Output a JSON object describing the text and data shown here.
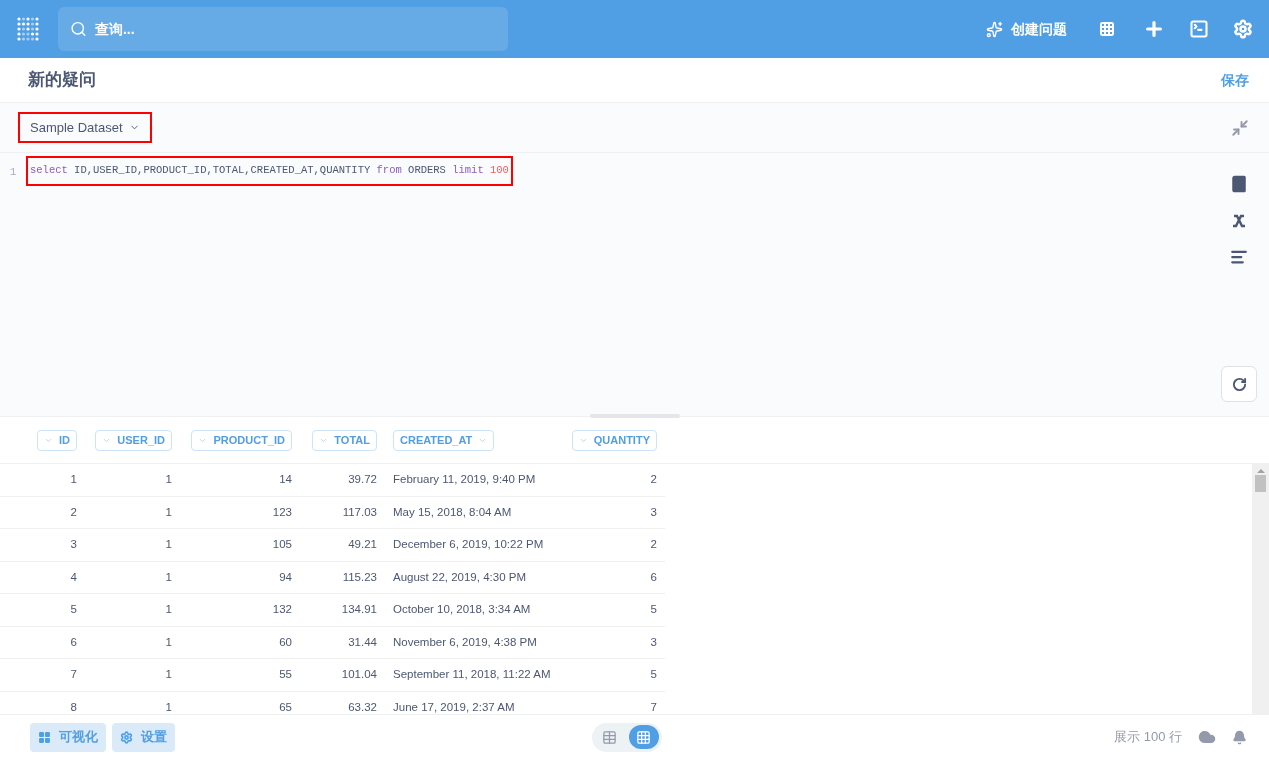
{
  "nav": {
    "search": {
      "placeholder": "查询..."
    },
    "new_question": "创建问题"
  },
  "header": {
    "title": "新的疑问",
    "save": "保存"
  },
  "editor": {
    "database": "Sample Dataset",
    "line_number": "1",
    "tokens": [
      {
        "text": "select",
        "kind": "keyword"
      },
      {
        "text": " ID,USER_ID,PRODUCT_ID,TOTAL,CREATED_AT,QUANTITY",
        "kind": "plain"
      },
      {
        "text": " from",
        "kind": "keyword"
      },
      {
        "text": " ORDERS ",
        "kind": "plain"
      },
      {
        "text": "limit",
        "kind": "keyword"
      },
      {
        "text": " 100",
        "kind": "number"
      }
    ]
  },
  "table": {
    "columns": [
      {
        "label": "ID",
        "kind": "number"
      },
      {
        "label": "USER_ID",
        "kind": "number"
      },
      {
        "label": "PRODUCT_ID",
        "kind": "number"
      },
      {
        "label": "TOTAL",
        "kind": "number"
      },
      {
        "label": "CREATED_AT",
        "kind": "date"
      },
      {
        "label": "QUANTITY",
        "kind": "number"
      }
    ],
    "rows": [
      [
        "1",
        "1",
        "14",
        "39.72",
        "February 11, 2019, 9:40 PM",
        "2"
      ],
      [
        "2",
        "1",
        "123",
        "117.03",
        "May 15, 2018, 8:04 AM",
        "3"
      ],
      [
        "3",
        "1",
        "105",
        "49.21",
        "December 6, 2019, 10:22 PM",
        "2"
      ],
      [
        "4",
        "1",
        "94",
        "115.23",
        "August 22, 2019, 4:30 PM",
        "6"
      ],
      [
        "5",
        "1",
        "132",
        "134.91",
        "October 10, 2018, 3:34 AM",
        "5"
      ],
      [
        "6",
        "1",
        "60",
        "31.44",
        "November 6, 2019, 4:38 PM",
        "3"
      ],
      [
        "7",
        "1",
        "55",
        "101.04",
        "September 11, 2018, 11:22 AM",
        "5"
      ],
      [
        "8",
        "1",
        "65",
        "63.32",
        "June 17, 2019, 2:37 AM",
        "7"
      ]
    ]
  },
  "footer": {
    "visualize": "可视化",
    "settings": "设置",
    "views": [
      {
        "kind": "table",
        "selected": false
      },
      {
        "kind": "grid",
        "selected": true
      }
    ],
    "row_count": "展示 100 行"
  }
}
